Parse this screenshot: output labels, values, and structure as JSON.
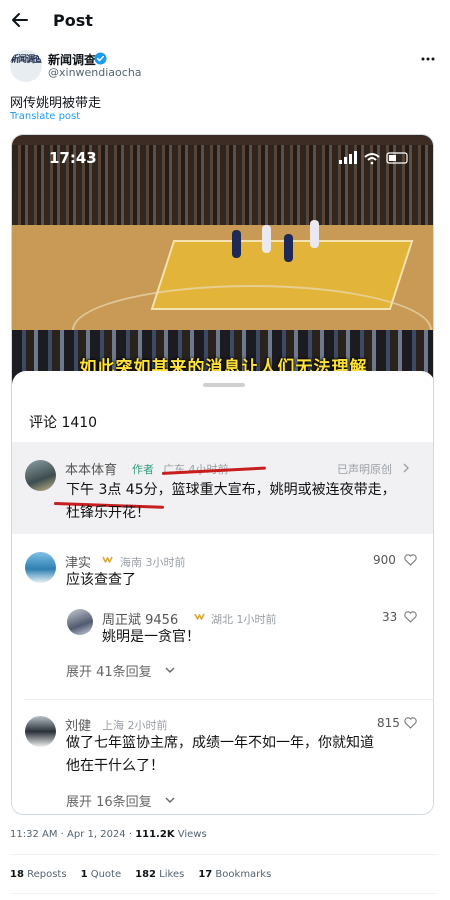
{
  "header": {
    "title": "Post"
  },
  "author": {
    "name": "新闻调查",
    "handle": "@xinwendiaocha",
    "avatar_text": "新闻调查"
  },
  "post": {
    "text": "网传姚明被带走",
    "translate_label": "Translate post"
  },
  "video": {
    "status_time": "17:43",
    "subtitle": "如此突如其来的消息让人们无法理解"
  },
  "comments_sheet": {
    "count_label": "评论 1410",
    "pinned": {
      "name": "本本体育",
      "author_tag": "作者",
      "meta": "广东 4小时前",
      "declaration": "已声明原创",
      "line1": "下午 3点 45分，篮球重大宣布，姚明或被连夜带走，",
      "line2": "杜锋乐开花！"
    },
    "comments": [
      {
        "name": "津实",
        "meta": "海南 3小时前",
        "likes": "900",
        "text": "应该查查了",
        "reply": {
          "name": "周正斌 9456",
          "meta": "湖北 1小时前",
          "likes": "33",
          "text": "姚明是一贪官！"
        },
        "expand": "展开 41条回复"
      },
      {
        "name": "刘健",
        "meta": "上海 2小时前",
        "likes": "815",
        "line1": "做了七年篮协主席，成绩一年不如一年，你就知道",
        "line2": "他在干什么了！",
        "expand": "展开 16条回复"
      }
    ]
  },
  "footer": {
    "timestamp": "11:32 AM · Apr 1, 2024 · ",
    "views_count": "111.2K",
    "views_label": " Views",
    "reposts_count": "18",
    "reposts_label": " Reposts",
    "quotes_count": "1",
    "quotes_label": " Quote",
    "likes_count": "182",
    "likes_label": " Likes",
    "bookmarks_count": "17",
    "bookmarks_label": " Bookmarks"
  },
  "colors": {
    "accent": "#1d9bf0",
    "subtitle": "#ffe23a",
    "author_tag": "#2f9d7e",
    "annotation_red": "#c81e1e"
  },
  "icons": [
    "back-arrow-icon",
    "verified-badge-icon",
    "more-icon",
    "heart-icon",
    "chevron-down-icon",
    "crown-icon"
  ]
}
